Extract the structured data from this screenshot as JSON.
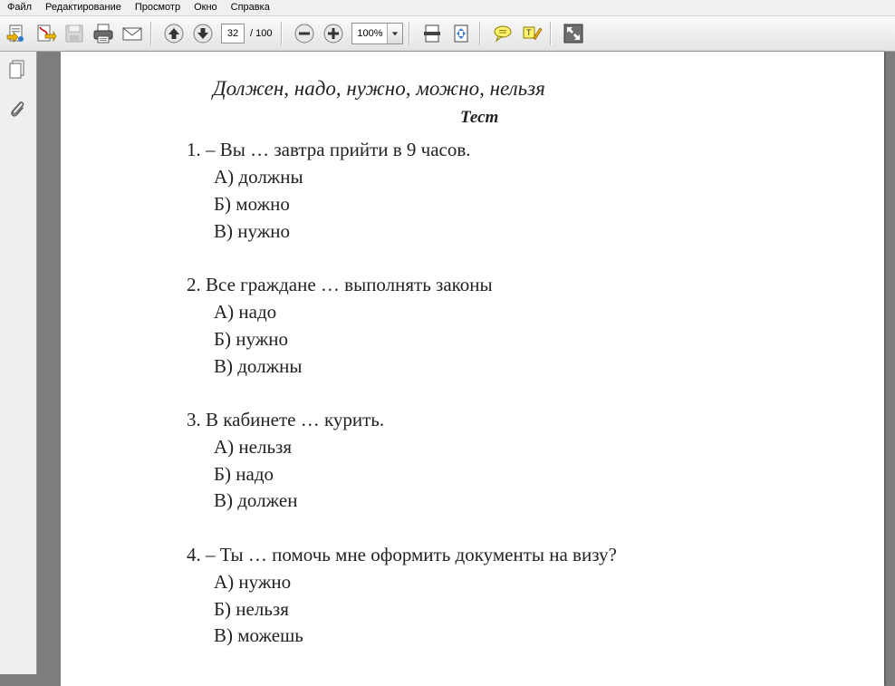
{
  "menu": [
    "Файл",
    "Редактирование",
    "Просмотр",
    "Окно",
    "Справка"
  ],
  "toolbar": {
    "page_current": "32",
    "page_total": "/ 100",
    "zoom": "100%"
  },
  "icons": {
    "create": "create-pdf-icon",
    "export": "export-icon",
    "save": "save-icon",
    "print": "print-icon",
    "email": "email-icon",
    "prev": "arrow-up-icon",
    "next": "arrow-down-icon",
    "zoom_out": "minus-icon",
    "zoom_in": "plus-icon",
    "fit_page": "fit-page-icon",
    "fit_width": "fit-width-icon",
    "comment": "comment-icon",
    "highlight": "highlight-icon",
    "fullscreen": "fullscreen-icon",
    "pages_panel": "pages-icon",
    "attachments_panel": "paperclip-icon"
  },
  "document": {
    "title": "Должен, надо, нужно, можно, нельзя",
    "subtitle": "Тест",
    "questions": [
      {
        "text": "1. – Вы … завтра прийти в 9 часов.",
        "options": [
          "А) должны",
          "Б) можно",
          "В) нужно"
        ]
      },
      {
        "text": "2. Все граждане … выполнять законы",
        "options": [
          "А) надо",
          "Б) нужно",
          "В) должны"
        ]
      },
      {
        "text": "3. В кабинете … курить.",
        "options": [
          "А) нельзя",
          "Б) надо",
          "В) должен"
        ]
      },
      {
        "text": "4. – Ты … помочь мне оформить документы на визу?",
        "options": [
          "А) нужно",
          "Б) нельзя",
          "В) можешь"
        ]
      }
    ]
  }
}
